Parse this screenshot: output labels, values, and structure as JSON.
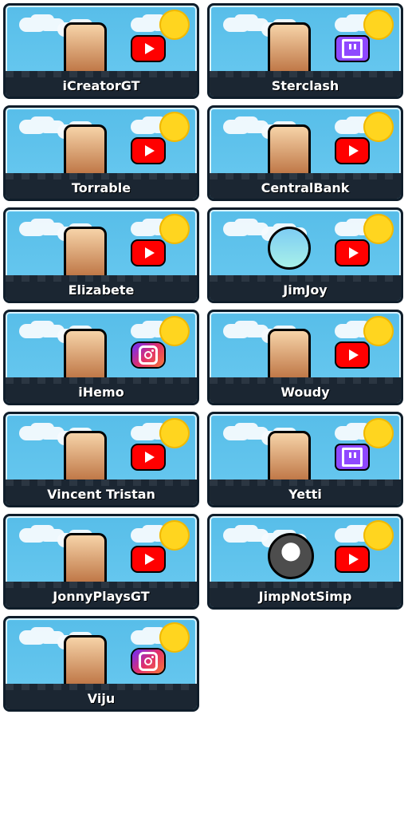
{
  "cards": [
    {
      "name": "iCreatorGT",
      "platform": "youtube",
      "avatar": "crystal-avatar-icon"
    },
    {
      "name": "Sterclash",
      "platform": "twitch",
      "avatar": "character-avatar-icon"
    },
    {
      "name": "Torrable",
      "platform": "youtube",
      "avatar": "angel-avatar-icon"
    },
    {
      "name": "CentralBank",
      "platform": "youtube",
      "avatar": "king-avatar-icon"
    },
    {
      "name": "Elizabete",
      "platform": "youtube",
      "avatar": "panda-avatar-icon"
    },
    {
      "name": "JimJoy",
      "platform": "youtube",
      "avatar": "cat-avatar-icon"
    },
    {
      "name": "iHemo",
      "platform": "instagram",
      "avatar": "fire-avatar-icon"
    },
    {
      "name": "Woudy",
      "platform": "youtube",
      "avatar": "jester-avatar-icon"
    },
    {
      "name": "Vincent Tristan",
      "platform": "youtube",
      "avatar": "wing-avatar-icon"
    },
    {
      "name": "Yetti",
      "platform": "twitch",
      "avatar": "hat-avatar-icon"
    },
    {
      "name": "JonnyPlaysGT",
      "platform": "youtube",
      "avatar": "wizard-avatar-icon"
    },
    {
      "name": "JimpNotSimp",
      "platform": "youtube",
      "avatar": "face-avatar-icon"
    },
    {
      "name": "Viju",
      "platform": "instagram",
      "avatar": "ice-avatar-icon"
    }
  ]
}
